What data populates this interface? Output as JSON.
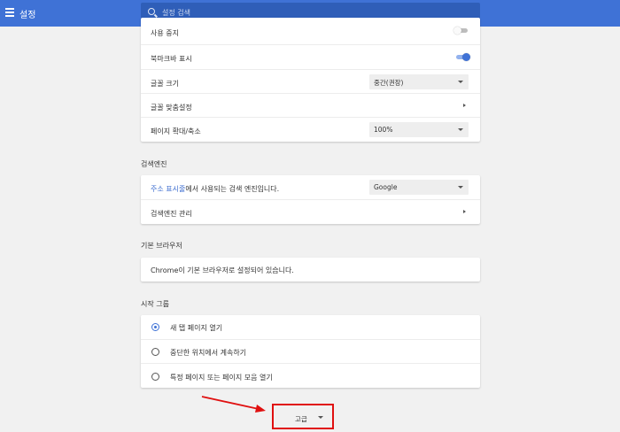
{
  "header": {
    "title": "설정",
    "search_placeholder": "설정 검색"
  },
  "appearance": {
    "partial_row_label": "사용 중지",
    "bookmarks_bar_label": "북마크바 표시",
    "font_size_label": "글꼴 크기",
    "font_size_value": "중간(권장)",
    "customize_fonts_label": "글꼴 맞춤설정",
    "page_zoom_label": "페이지 확대/축소",
    "page_zoom_value": "100%"
  },
  "search_engine": {
    "section_title": "검색엔진",
    "link_text": "주소 표시줄",
    "row_label_rest": "에서 사용되는 검색 엔진입니다.",
    "engine_value": "Google",
    "manage_label": "검색엔진 관리"
  },
  "default_browser": {
    "section_title": "기본 브라우저",
    "status_text": "Chrome이 기본 브라우저로 설정되어 있습니다."
  },
  "startup": {
    "section_title": "시작 그룹",
    "options": [
      {
        "label": "새 탭 페이지 열기",
        "selected": true
      },
      {
        "label": "중단한 위치에서 계속하기",
        "selected": false
      },
      {
        "label": "특정 페이지 또는 페이지 모음 열기",
        "selected": false
      }
    ]
  },
  "advanced": {
    "label": "고급"
  },
  "colors": {
    "header_bg": "#3f72d6",
    "accent": "#3f72d6",
    "highlight_box": "#e01010",
    "annotation_arrow": "#e01010"
  }
}
